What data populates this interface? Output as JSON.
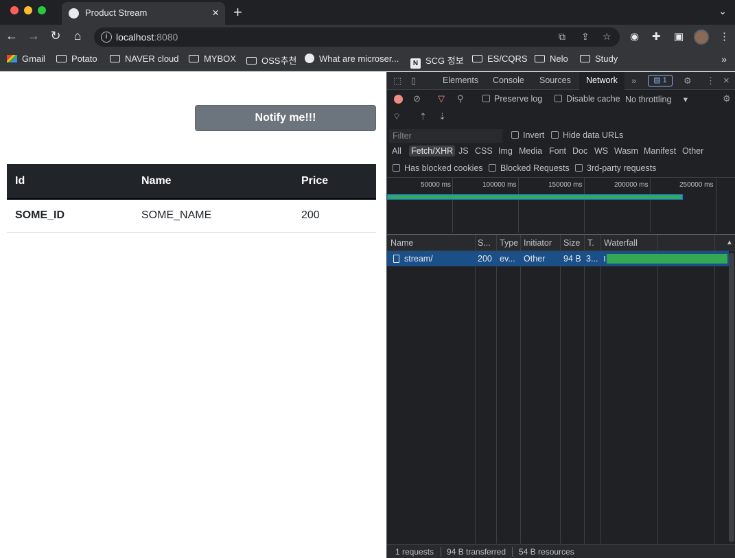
{
  "browser": {
    "tab_title": "Product Stream",
    "url_host": "localhost",
    "url_port": ":8080",
    "bookmarks": [
      "Gmail",
      "Potato",
      "NAVER cloud",
      "MYBOX",
      "OSS추천",
      "What are microser...",
      "SCG 정보",
      "ES/CQRS",
      "Nelo",
      "Study"
    ],
    "notion_logo": "N",
    "more_bookmarks": "»"
  },
  "page": {
    "notify_button": "Notify me!!!",
    "table": {
      "headers": [
        "Id",
        "Name",
        "Price"
      ],
      "rows": [
        [
          "SOME_ID",
          "SOME_NAME",
          "200"
        ]
      ]
    }
  },
  "devtools": {
    "tabs": [
      "Elements",
      "Console",
      "Sources",
      "Network"
    ],
    "active_tab": "Network",
    "messages_count": "1",
    "preserve_log": "Preserve log",
    "disable_cache": "Disable cache",
    "throttling": "No throttling",
    "filter_placeholder": "Filter",
    "invert": "Invert",
    "hide_data_urls": "Hide data URLs",
    "type_filters": [
      "All",
      "Fetch/XHR",
      "JS",
      "CSS",
      "Img",
      "Media",
      "Font",
      "Doc",
      "WS",
      "Wasm",
      "Manifest",
      "Other"
    ],
    "active_type": "Fetch/XHR",
    "has_blocked_cookies": "Has blocked cookies",
    "blocked_requests": "Blocked Requests",
    "third_party": "3rd-party requests",
    "timeline_ticks": [
      "50000 ms",
      "100000 ms",
      "150000 ms",
      "200000 ms",
      "250000 ms"
    ],
    "columns": [
      "Name",
      "S...",
      "Type",
      "Initiator",
      "Size",
      "T.",
      "Waterfall"
    ],
    "requests": [
      {
        "name": "stream/",
        "status": "200",
        "type": "ev...",
        "initiator": "Other",
        "size": "94 B",
        "time": "3..."
      }
    ],
    "status_bar": {
      "requests": "1 requests",
      "transferred": "94 B transferred",
      "resources": "54 B resources"
    }
  }
}
